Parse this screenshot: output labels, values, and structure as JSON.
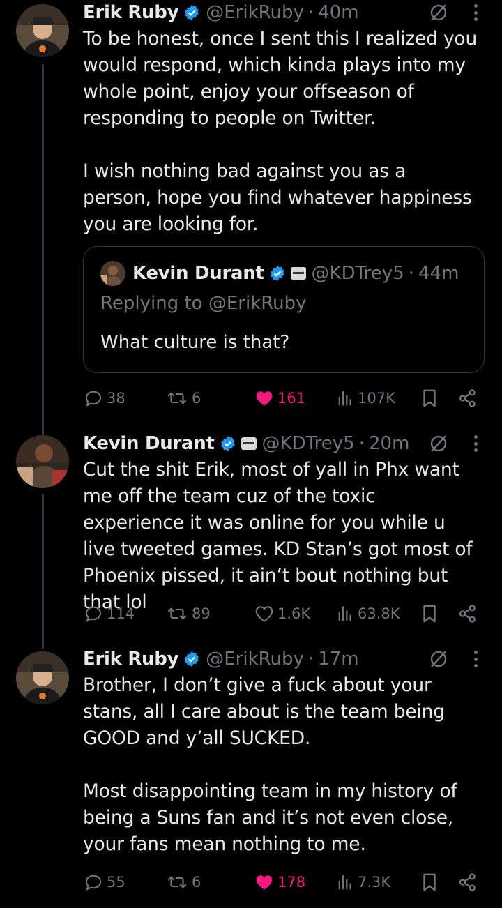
{
  "tweets": [
    {
      "name": "Erik Ruby",
      "handle": "@ErikRuby",
      "dot": "·",
      "time": "40m",
      "text": "To be honest, once I sent this I realized you would respond, which kinda plays into my whole point, enjoy your offseason of responding to people on Twitter.\n\nI wish nothing bad against you as a person, hope you find whatever happiness you are looking for.",
      "quote": {
        "name": "Kevin Durant",
        "handle": "@KDTrey5",
        "dot": "·",
        "time": "44m",
        "replying_to": "Replying to @ErikRuby",
        "text": "What culture is that?"
      },
      "actions": {
        "replies": "38",
        "retweets": "6",
        "likes": "161",
        "views": "107K"
      },
      "liked": true
    },
    {
      "name": "Kevin Durant",
      "handle": "@KDTrey5",
      "dot": "·",
      "time": "20m",
      "text": "Cut the shit Erik, most of yall in Phx want me off the team cuz of the toxic experience it was online for you while u live tweeted games. KD Stan’s got most of Phoenix pissed, it ain’t bout nothing but that lol",
      "actions": {
        "replies": "114",
        "retweets": "89",
        "likes": "1.6K",
        "views": "63.8K"
      },
      "liked": false
    },
    {
      "name": "Erik Ruby",
      "handle": "@ErikRuby",
      "dot": "·",
      "time": "17m",
      "text": "Brother, I don’t give a fuck about your stans, all I care about is the team being GOOD and y’all SUCKED.\n\nMost disappointing team in my history of being a Suns fan and it’s not even close, your fans mean nothing to me.",
      "actions": {
        "replies": "55",
        "retweets": "6",
        "likes": "178",
        "views": "7.3K"
      },
      "liked": true
    }
  ],
  "icons": {
    "verified": "verified-badge-icon",
    "affiliate": "affiliate-badge-icon",
    "grok": "slashed-circle-icon",
    "more": "more-vertical-icon",
    "reply": "reply-bubble-icon",
    "retweet": "retweet-icon",
    "like": "heart-icon",
    "views": "views-bars-icon",
    "bookmark": "bookmark-icon",
    "share": "share-icon"
  },
  "colors": {
    "accent_blue": "#1d9bf0",
    "like_pink": "#f91880",
    "muted": "#71767b",
    "text": "#e7e9ea",
    "bg": "#000000"
  }
}
